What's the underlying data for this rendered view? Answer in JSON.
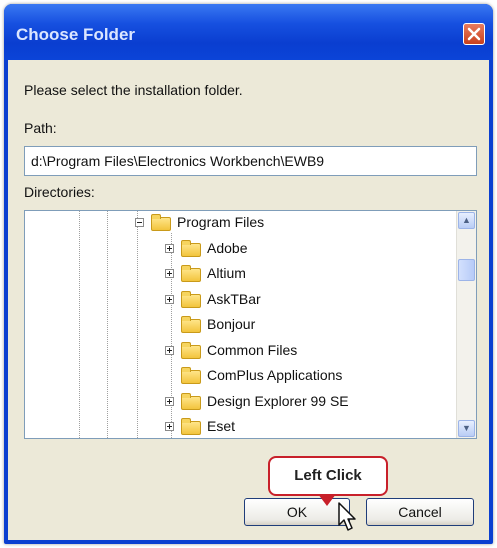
{
  "dialog": {
    "title": "Choose Folder",
    "prompt": "Please select the installation folder.",
    "path_label": "Path:",
    "path_value": "d:\\Program Files\\Electronics Workbench\\EWB9",
    "directories_label": "Directories:"
  },
  "tree": {
    "items": [
      {
        "label": "Program Files",
        "expander": "minus"
      },
      {
        "label": "Adobe",
        "expander": "plus"
      },
      {
        "label": "Altium",
        "expander": "plus"
      },
      {
        "label": "AskTBar",
        "expander": "plus"
      },
      {
        "label": "Bonjour",
        "expander": "none"
      },
      {
        "label": "Common Files",
        "expander": "plus"
      },
      {
        "label": "ComPlus Applications",
        "expander": "none"
      },
      {
        "label": "Design Explorer 99 SE",
        "expander": "plus"
      },
      {
        "label": "Eset",
        "expander": "plus"
      }
    ]
  },
  "buttons": {
    "ok": "OK",
    "cancel": "Cancel"
  },
  "annotation": {
    "callout": "Left Click"
  },
  "colors": {
    "titlebar": "#0a3ed0",
    "dialog_bg": "#ece9d8",
    "callout_border": "#c8202a",
    "close_button": "#c8401d"
  },
  "icons": [
    "close-icon",
    "folder-icon",
    "expander-icon",
    "scroll-up-icon",
    "scroll-down-icon",
    "mouse-cursor-icon"
  ]
}
